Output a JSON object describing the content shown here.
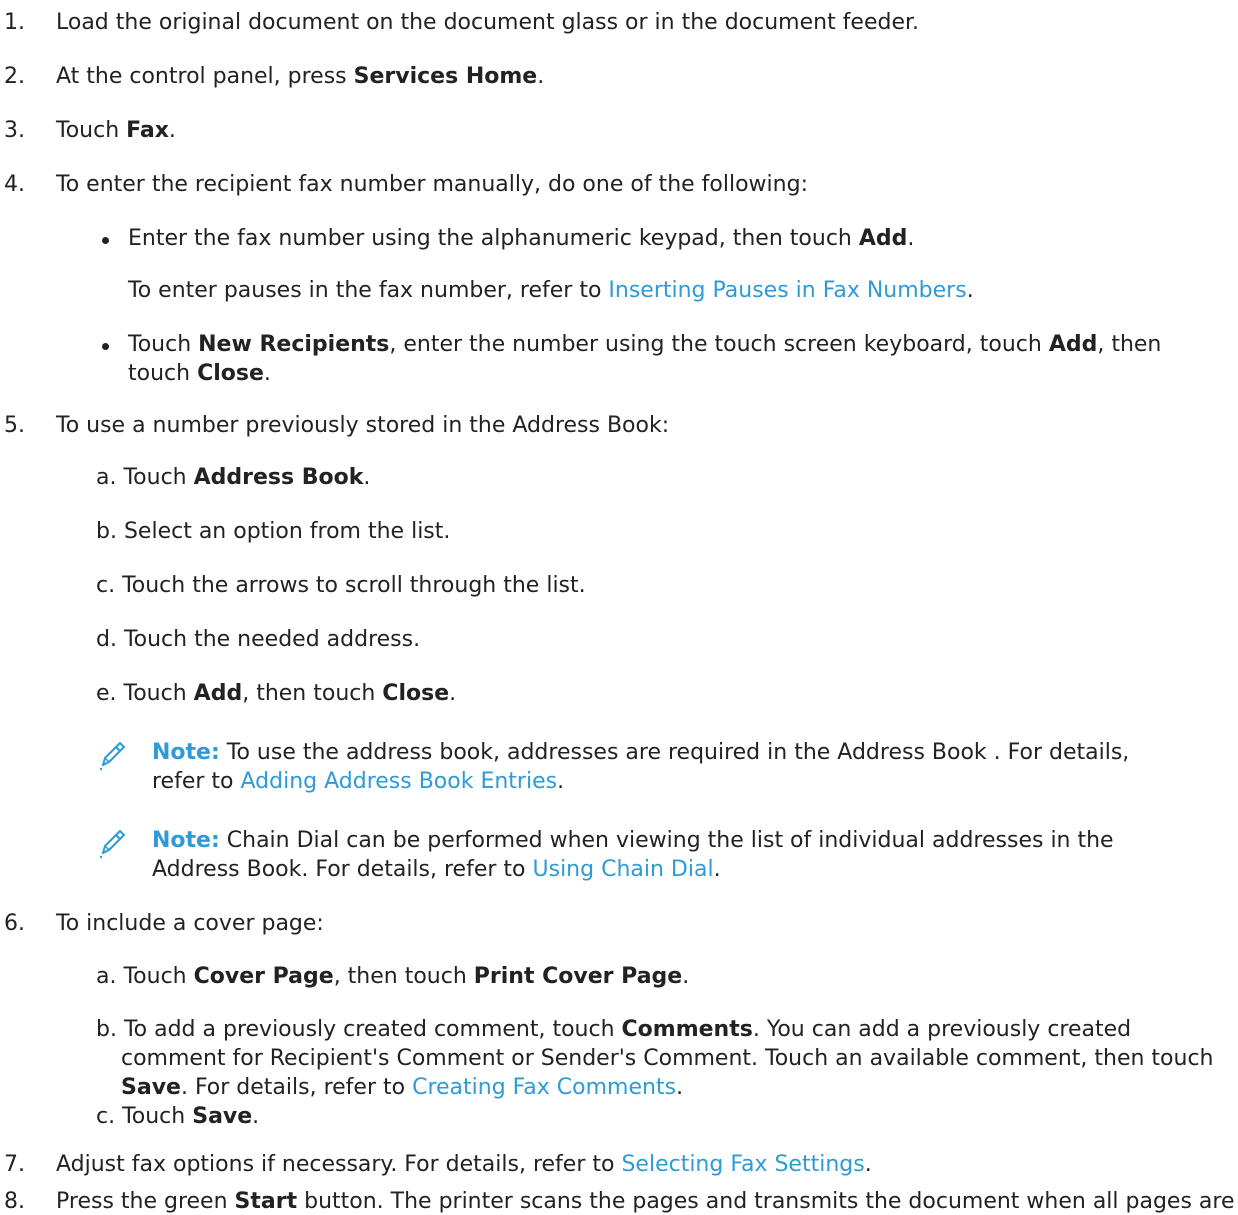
{
  "colors": {
    "text": "#222222",
    "link": "#2f9bd6",
    "note_icon": "#2f9bd6",
    "background": "#ffffff"
  },
  "steps": [
    {
      "num": "1.",
      "text": "Load the original document on the document glass or in the document feeder."
    },
    {
      "num": "2.",
      "pre": "At the control panel, press ",
      "bold": "Services Home",
      "post": "."
    },
    {
      "num": "3.",
      "pre": "Touch ",
      "bold": "Fax",
      "post": "."
    },
    {
      "num": "4.",
      "text": "To enter the recipient fax number manually, do one of the following:",
      "bullet1": {
        "pre": "Enter the fax number using the alphanumeric keypad, then touch ",
        "bold": "Add",
        "post": ".",
        "para_pre": "To enter pauses in the fax number, refer to ",
        "para_link": "Inserting Pauses in Fax Numbers",
        "para_post": "."
      },
      "bullet2": {
        "t1": "Touch ",
        "b1": "New Recipients",
        "t2": ", enter the number using the touch screen keyboard, touch ",
        "b2": "Add",
        "t3": ", then touch ",
        "b3": "Close",
        "t4": "."
      }
    },
    {
      "num": "5.",
      "text": "To use a number previously stored in the Address Book:",
      "a": {
        "pre": "a. Touch ",
        "bold": "Address Book",
        "post": "."
      },
      "b": "b. Select an option from the list.",
      "c": "c. Touch the arrows to scroll through the list.",
      "d": "d. Touch the needed address.",
      "e": {
        "pre": "e. Touch ",
        "bold1": "Add",
        "mid": ", then touch ",
        "bold2": "Close",
        "post": "."
      },
      "note1": {
        "label": "Note:",
        "text": " To use the address book, addresses are required in the Address Book . For details, refer to ",
        "link": "Adding Address Book Entries",
        "post": "."
      },
      "note2": {
        "label": "Note:",
        "text": " Chain Dial can be performed when viewing the list of individual addresses in the Address Book. For details, refer to ",
        "link": "Using Chain Dial",
        "post": "."
      }
    },
    {
      "num": "6.",
      "text": "To include a cover page:",
      "a": {
        "pre": "a. Touch ",
        "bold1": "Cover Page",
        "mid": ", then touch ",
        "bold2": "Print Cover Page",
        "post": "."
      },
      "b": {
        "t1": "b. To add a previously created comment, touch ",
        "b1": "Comments",
        "t2": ". You can add a previously created comment for Recipient's Comment or Sender's Comment. Touch an available comment, then touch ",
        "b2": "Save",
        "t3": ". For details, refer to ",
        "link": "Creating Fax Comments",
        "t4": "."
      },
      "c": {
        "pre": "c. Touch ",
        "bold": "Save",
        "post": "."
      }
    },
    {
      "num": "7.",
      "pre": "Adjust fax options if necessary. For details, refer to ",
      "link": "Selecting Fax Settings",
      "post": "."
    },
    {
      "num": "8.",
      "pre": "Press the green ",
      "bold": "Start",
      "post": " button. The printer scans the pages and transmits the document when all pages are scanned."
    }
  ]
}
